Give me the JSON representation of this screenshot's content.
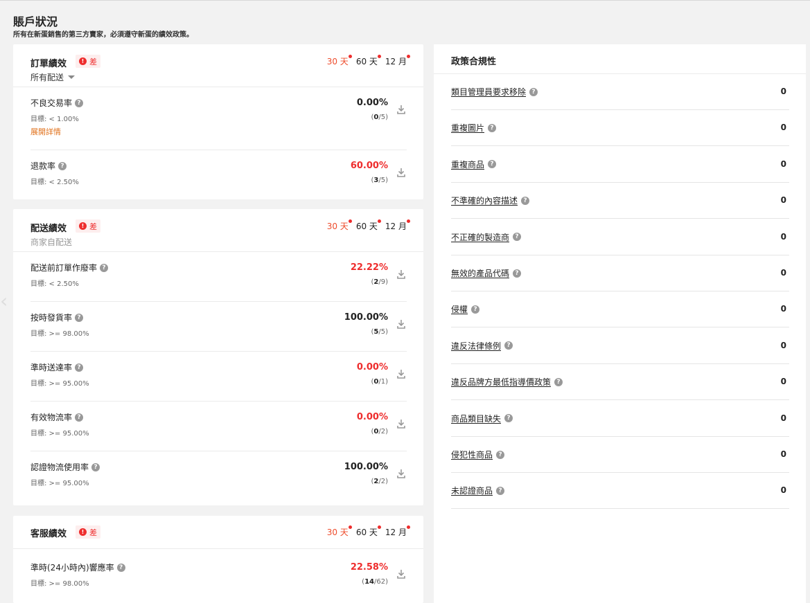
{
  "page": {
    "title": "賬戶狀況",
    "subtitle": "所有在新蛋銷售的第三方賣家，必須遵守新蛋的績效政策。"
  },
  "badge_bad": "差",
  "periods": [
    "30 天",
    "60 天",
    "12 月"
  ],
  "order_card": {
    "title": "訂單績效",
    "scope": "所有配送",
    "metrics": [
      {
        "name": "不良交易率",
        "target": "目標: < 1.00%",
        "link": "展開詳情",
        "value": "0.00%",
        "num": "0",
        "den": "/5"
      },
      {
        "name": "退款率",
        "target": "目標: < 2.50%",
        "value": "60.00%",
        "num": "3",
        "den": "/5"
      }
    ]
  },
  "shipping_card": {
    "title": "配送績效",
    "scope": "商家自配送",
    "metrics": [
      {
        "name": "配送前訂單作廢率",
        "target": "目標: < 2.50%",
        "value": "22.22%",
        "num": "2",
        "den": "/9"
      },
      {
        "name": "按時發貨率",
        "target": "目標: >= 98.00%",
        "value": "100.00%",
        "num": "5",
        "den": "/5"
      },
      {
        "name": "準時送達率",
        "target": "目標: >= 95.00%",
        "value": "0.00%",
        "num": "0",
        "den": "/1"
      },
      {
        "name": "有效物流率",
        "target": "目標: >= 95.00%",
        "value": "0.00%",
        "num": "0",
        "den": "/2"
      },
      {
        "name": "認證物流使用率",
        "target": "目標: >= 95.00%",
        "value": "100.00%",
        "num": "2",
        "den": "/2"
      }
    ]
  },
  "service_card": {
    "title": "客服績效",
    "metrics": [
      {
        "name": "準時(24小時內)響應率",
        "target": "目標: >= 98.00%",
        "value": "22.58%",
        "num": "14",
        "den": "/62"
      }
    ]
  },
  "policy_card": {
    "title": "政策合規性",
    "items": [
      {
        "name": "類目管理員要求移除",
        "value": "0"
      },
      {
        "name": "重複圖片",
        "value": "0"
      },
      {
        "name": "重複商品",
        "value": "0"
      },
      {
        "name": "不準確的內容描述",
        "value": "0"
      },
      {
        "name": "不正確的製造商",
        "value": "0"
      },
      {
        "name": "無效的產品代碼",
        "value": "0"
      },
      {
        "name": "侵權",
        "value": "0"
      },
      {
        "name": "違反法律條例",
        "value": "0"
      },
      {
        "name": "違反品牌方最低指導價政策",
        "value": "0"
      },
      {
        "name": "商品類目缺失",
        "value": "0"
      },
      {
        "name": "侵犯性商品",
        "value": "0"
      },
      {
        "name": "未認證商品",
        "value": "0"
      }
    ]
  },
  "colors": {
    "red": "#ee2d2d",
    "orange_active": "#ee4d2d",
    "link_orange": "#e0711b"
  },
  "icons": {
    "help": "question-mark-circle-icon",
    "download": "download-icon",
    "status": "exclamation-circle-icon",
    "dropdown": "caret-down-icon"
  }
}
